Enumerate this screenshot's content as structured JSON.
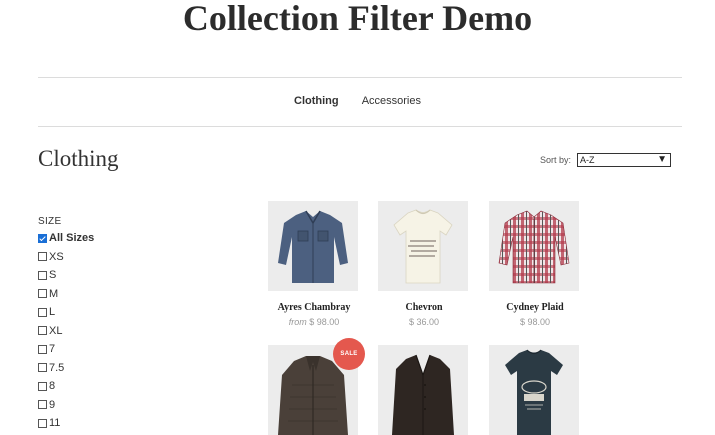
{
  "site_title": "Collection Filter Demo",
  "nav": [
    {
      "label": "Clothing",
      "active": true
    },
    {
      "label": "Accessories",
      "active": false
    }
  ],
  "collection_title": "Clothing",
  "sort": {
    "label": "Sort by:",
    "selected": "A-Z"
  },
  "filter": {
    "heading": "SIZE",
    "options": [
      {
        "label": "All Sizes",
        "checked": true
      },
      {
        "label": "XS",
        "checked": false
      },
      {
        "label": "S",
        "checked": false
      },
      {
        "label": "M",
        "checked": false
      },
      {
        "label": "L",
        "checked": false
      },
      {
        "label": "XL",
        "checked": false
      },
      {
        "label": "7",
        "checked": false
      },
      {
        "label": "7.5",
        "checked": false
      },
      {
        "label": "8",
        "checked": false
      },
      {
        "label": "9",
        "checked": false
      },
      {
        "label": "11",
        "checked": false
      }
    ]
  },
  "products": [
    {
      "name": "Ayres Chambray",
      "price_prefix": "from",
      "price": "$ 98.00"
    },
    {
      "name": "Chevron",
      "price_prefix": "",
      "price": "$ 36.00"
    },
    {
      "name": "Cydney Plaid",
      "price_prefix": "",
      "price": "$ 98.00"
    },
    {
      "name": "",
      "price_prefix": "",
      "price": "",
      "badge": "SALE"
    },
    {
      "name": "",
      "price_prefix": "",
      "price": ""
    },
    {
      "name": "",
      "price_prefix": "",
      "price": ""
    }
  ],
  "colors": {
    "sale_badge": "#e4584e",
    "checkbox_checked": "#1a6fd6"
  }
}
